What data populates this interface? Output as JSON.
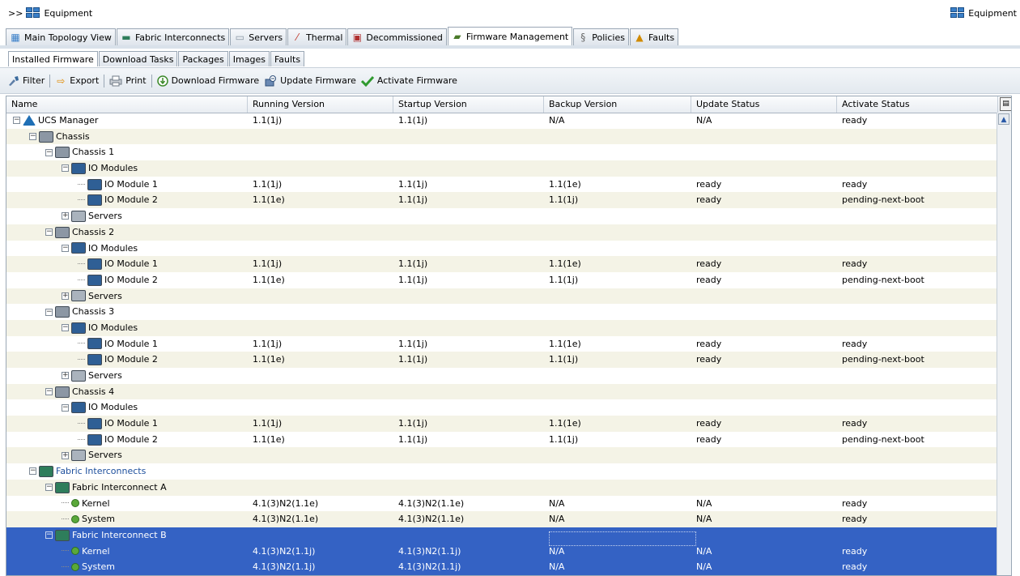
{
  "breadcrumb": {
    "prefix": ">>",
    "label": "Equipment",
    "icon": "equipment-icon"
  },
  "right_label": {
    "label": "Equipment",
    "icon": "equipment-icon"
  },
  "main_tabs": [
    {
      "label": "Main Topology View",
      "icon": "topology-icon",
      "active": false
    },
    {
      "label": "Fabric Interconnects",
      "icon": "fabric-interconnect-icon",
      "active": false
    },
    {
      "label": "Servers",
      "icon": "server-icon",
      "active": false
    },
    {
      "label": "Thermal",
      "icon": "thermometer-icon",
      "active": false
    },
    {
      "label": "Decommissioned",
      "icon": "decommissioned-icon",
      "active": false
    },
    {
      "label": "Firmware Management",
      "icon": "firmware-icon",
      "active": true
    },
    {
      "label": "Policies",
      "icon": "policies-icon",
      "active": false
    },
    {
      "label": "Faults",
      "icon": "faults-icon",
      "active": false
    }
  ],
  "sub_tabs": [
    {
      "label": "Installed Firmware",
      "active": true
    },
    {
      "label": "Download Tasks",
      "active": false
    },
    {
      "label": "Packages",
      "active": false
    },
    {
      "label": "Images",
      "active": false
    },
    {
      "label": "Faults",
      "active": false
    }
  ],
  "toolbar": {
    "filter": "Filter",
    "export": "Export",
    "print": "Print",
    "download": "Download Firmware",
    "update": "Update Firmware",
    "activate": "Activate Firmware"
  },
  "columns": [
    "Name",
    "Running Version",
    "Startup Version",
    "Backup Version",
    "Update Status",
    "Activate Status"
  ],
  "colors": {
    "selection": "#3462c4",
    "alt_row": "#f4f3e6",
    "link_text": "#1d4f9c"
  },
  "rows": [
    {
      "name": "UCS Manager",
      "level": 0,
      "expander": "minus",
      "icon": "ucs-manager-icon",
      "running": "1.1(1j)",
      "startup": "1.1(1j)",
      "backup": "N/A",
      "update": "N/A",
      "activate": "ready",
      "selected": false
    },
    {
      "name": "Chassis",
      "level": 1,
      "expander": "minus",
      "icon": "chassis-icon",
      "running": "",
      "startup": "",
      "backup": "",
      "update": "",
      "activate": "",
      "selected": false
    },
    {
      "name": "Chassis 1",
      "level": 2,
      "expander": "minus",
      "icon": "chassis-icon",
      "running": "",
      "startup": "",
      "backup": "",
      "update": "",
      "activate": "",
      "selected": false
    },
    {
      "name": "IO Modules",
      "level": 3,
      "expander": "minus",
      "icon": "io-module-icon",
      "running": "",
      "startup": "",
      "backup": "",
      "update": "",
      "activate": "",
      "selected": false
    },
    {
      "name": "IO Module 1",
      "level": 4,
      "expander": "",
      "icon": "io-module-icon",
      "running": "1.1(1j)",
      "startup": "1.1(1j)",
      "backup": "1.1(1e)",
      "update": "ready",
      "activate": "ready",
      "selected": false
    },
    {
      "name": "IO Module 2",
      "level": 4,
      "expander": "",
      "icon": "io-module-icon",
      "running": "1.1(1e)",
      "startup": "1.1(1j)",
      "backup": "1.1(1j)",
      "update": "ready",
      "activate": "pending-next-boot",
      "selected": false
    },
    {
      "name": "Servers",
      "level": 3,
      "expander": "plus",
      "icon": "server-icon",
      "running": "",
      "startup": "",
      "backup": "",
      "update": "",
      "activate": "",
      "selected": false
    },
    {
      "name": "Chassis 2",
      "level": 2,
      "expander": "minus",
      "icon": "chassis-icon",
      "running": "",
      "startup": "",
      "backup": "",
      "update": "",
      "activate": "",
      "selected": false
    },
    {
      "name": "IO Modules",
      "level": 3,
      "expander": "minus",
      "icon": "io-module-icon",
      "running": "",
      "startup": "",
      "backup": "",
      "update": "",
      "activate": "",
      "selected": false
    },
    {
      "name": "IO Module 1",
      "level": 4,
      "expander": "",
      "icon": "io-module-icon",
      "running": "1.1(1j)",
      "startup": "1.1(1j)",
      "backup": "1.1(1e)",
      "update": "ready",
      "activate": "ready",
      "selected": false
    },
    {
      "name": "IO Module 2",
      "level": 4,
      "expander": "",
      "icon": "io-module-icon",
      "running": "1.1(1e)",
      "startup": "1.1(1j)",
      "backup": "1.1(1j)",
      "update": "ready",
      "activate": "pending-next-boot",
      "selected": false
    },
    {
      "name": "Servers",
      "level": 3,
      "expander": "plus",
      "icon": "server-icon",
      "running": "",
      "startup": "",
      "backup": "",
      "update": "",
      "activate": "",
      "selected": false
    },
    {
      "name": "Chassis 3",
      "level": 2,
      "expander": "minus",
      "icon": "chassis-icon",
      "running": "",
      "startup": "",
      "backup": "",
      "update": "",
      "activate": "",
      "selected": false
    },
    {
      "name": "IO Modules",
      "level": 3,
      "expander": "minus",
      "icon": "io-module-icon",
      "running": "",
      "startup": "",
      "backup": "",
      "update": "",
      "activate": "",
      "selected": false
    },
    {
      "name": "IO Module 1",
      "level": 4,
      "expander": "",
      "icon": "io-module-icon",
      "running": "1.1(1j)",
      "startup": "1.1(1j)",
      "backup": "1.1(1e)",
      "update": "ready",
      "activate": "ready",
      "selected": false
    },
    {
      "name": "IO Module 2",
      "level": 4,
      "expander": "",
      "icon": "io-module-icon",
      "running": "1.1(1e)",
      "startup": "1.1(1j)",
      "backup": "1.1(1j)",
      "update": "ready",
      "activate": "pending-next-boot",
      "selected": false
    },
    {
      "name": "Servers",
      "level": 3,
      "expander": "plus",
      "icon": "server-icon",
      "running": "",
      "startup": "",
      "backup": "",
      "update": "",
      "activate": "",
      "selected": false
    },
    {
      "name": "Chassis 4",
      "level": 2,
      "expander": "minus",
      "icon": "chassis-icon",
      "running": "",
      "startup": "",
      "backup": "",
      "update": "",
      "activate": "",
      "selected": false
    },
    {
      "name": "IO Modules",
      "level": 3,
      "expander": "minus",
      "icon": "io-module-icon",
      "running": "",
      "startup": "",
      "backup": "",
      "update": "",
      "activate": "",
      "selected": false
    },
    {
      "name": "IO Module 1",
      "level": 4,
      "expander": "",
      "icon": "io-module-icon",
      "running": "1.1(1j)",
      "startup": "1.1(1j)",
      "backup": "1.1(1e)",
      "update": "ready",
      "activate": "ready",
      "selected": false
    },
    {
      "name": "IO Module 2",
      "level": 4,
      "expander": "",
      "icon": "io-module-icon",
      "running": "1.1(1e)",
      "startup": "1.1(1j)",
      "backup": "1.1(1j)",
      "update": "ready",
      "activate": "pending-next-boot",
      "selected": false
    },
    {
      "name": "Servers",
      "level": 3,
      "expander": "plus",
      "icon": "server-icon",
      "running": "",
      "startup": "",
      "backup": "",
      "update": "",
      "activate": "",
      "selected": false
    },
    {
      "name": "Fabric Interconnects",
      "level": 1,
      "expander": "minus",
      "icon": "fabric-interconnect-icon",
      "running": "",
      "startup": "",
      "backup": "",
      "update": "",
      "activate": "",
      "selected": false,
      "link": true
    },
    {
      "name": "Fabric Interconnect A",
      "level": 2,
      "expander": "minus",
      "icon": "fabric-interconnect-icon",
      "running": "",
      "startup": "",
      "backup": "",
      "update": "",
      "activate": "",
      "selected": false
    },
    {
      "name": "Kernel",
      "level": 3,
      "expander": "",
      "icon": "firmware-image-icon",
      "running": "4.1(3)N2(1.1e)",
      "startup": "4.1(3)N2(1.1e)",
      "backup": "N/A",
      "update": "N/A",
      "activate": "ready",
      "selected": false
    },
    {
      "name": "System",
      "level": 3,
      "expander": "",
      "icon": "firmware-image-icon",
      "running": "4.1(3)N2(1.1e)",
      "startup": "4.1(3)N2(1.1e)",
      "backup": "N/A",
      "update": "N/A",
      "activate": "ready",
      "selected": false
    },
    {
      "name": "Fabric Interconnect B",
      "level": 2,
      "expander": "minus",
      "icon": "fabric-interconnect-icon",
      "running": "",
      "startup": "",
      "backup": "",
      "update": "",
      "activate": "",
      "selected": true
    },
    {
      "name": "Kernel",
      "level": 3,
      "expander": "",
      "icon": "firmware-image-icon",
      "running": "4.1(3)N2(1.1j)",
      "startup": "4.1(3)N2(1.1j)",
      "backup": "N/A",
      "update": "N/A",
      "activate": "ready",
      "selected": true
    },
    {
      "name": "System",
      "level": 3,
      "expander": "",
      "icon": "firmware-image-icon",
      "running": "4.1(3)N2(1.1j)",
      "startup": "4.1(3)N2(1.1j)",
      "backup": "N/A",
      "update": "N/A",
      "activate": "ready",
      "selected": true
    }
  ]
}
